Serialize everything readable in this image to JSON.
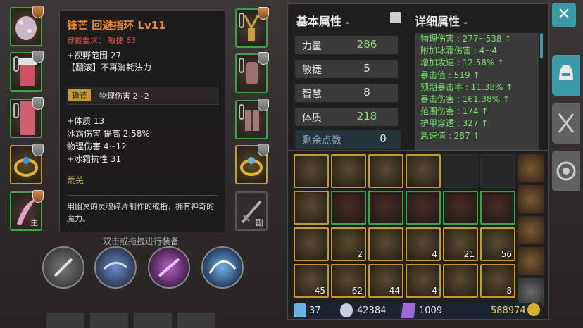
{
  "tooltip": {
    "name": "锋芒 回避指环 Lv11",
    "requirement": "穿戴要求： 敏捷 83",
    "props": [
      "+视野范围 27",
      "【翻滚】不再消耗法力"
    ],
    "tag": "锋芒",
    "tag_effect": "物理伤害 2~2",
    "stats": [
      "+体质 13",
      "冰霜伤害 提高 2.58%",
      "物理伤害 4~12",
      "+冰霜抗性 31"
    ],
    "set_name": "荒芜",
    "description": "用幽冥的灵魂碎片制作的戒指，拥有神奇的魔力。"
  },
  "hint": "双击或拖拽进行装备",
  "slots": {
    "offhand_label": "主",
    "weapon_label": "副"
  },
  "base_attributes": {
    "title": "基本属性",
    "rows": [
      {
        "label": "力量",
        "value": "286"
      },
      {
        "label": "敏捷",
        "value": "5"
      },
      {
        "label": "智慧",
        "value": "8"
      },
      {
        "label": "体质",
        "value": "218"
      }
    ],
    "remaining_label": "剩余点数",
    "remaining_value": "0"
  },
  "detail_attributes": {
    "title": "详细属性",
    "lines": [
      "物理伤害 : 277~538 ↑",
      "附加冰霜伤害 : 4~4",
      "增加攻速 : 12.58% ↑",
      "暴击值 : 519 ↑",
      "预期暴击率 : 11.38% ↑",
      "暴击伤害 : 161.38% ↑",
      "范围伤害 : 174 ↑",
      "护甲穿透 : 327 ↑",
      "急速值 : 287 ↑"
    ]
  },
  "inventory": {
    "counts": {
      "r3c2": "2",
      "r3c4": "4",
      "r3c5": "21",
      "r3c6": "56",
      "r4c1": "45",
      "r4c2": "62",
      "r4c3": "44",
      "r4c4": "4",
      "r4c6": "8"
    }
  },
  "currency": {
    "scrolls": "37",
    "souls": "42384",
    "gems": "1009",
    "gold": "588974"
  },
  "close_label": "✕",
  "colors": {
    "accent": "#3a9aa8",
    "gold_border": "#c49a2c",
    "green_border": "#3fa04a",
    "stat_green": "#74e06a",
    "title_orange": "#e88a3a",
    "requirement_red": "#e0504a"
  }
}
